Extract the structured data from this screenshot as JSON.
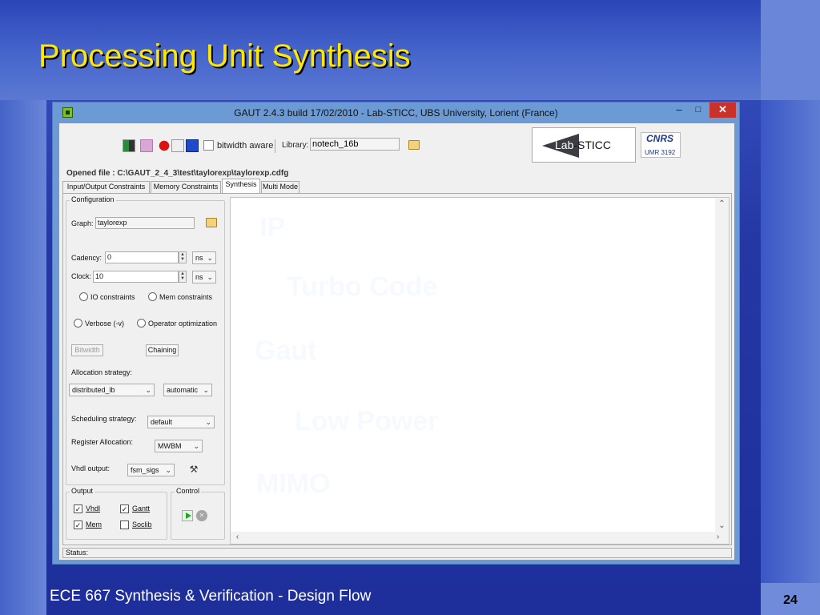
{
  "slide": {
    "title": "Processing Unit Synthesis",
    "footer": "ECE 667 Synthesis & Verification - Design Flow",
    "page_number": "24"
  },
  "window": {
    "title": "GAUT 2.4.3 build 17/02/2010 - Lab-STICC, UBS University, Lorient (France)",
    "minimize": "–",
    "maximize": "□",
    "close": "✕"
  },
  "toolbar": {
    "bitwidth_label": "bitwidth aware",
    "library_label": "Library:",
    "library_value": "notech_16b",
    "logo_lab": "Lab",
    "logo_sticc": "STICC",
    "logo_cnrs": "CNRS",
    "logo_umr": "UMR 3192"
  },
  "opened_file": "Opened file : C:\\GAUT_2_4_3\\test\\taylorexp\\taylorexp.cdfg",
  "tabs": [
    {
      "label": "Input/Output Constraints",
      "active": false
    },
    {
      "label": "Memory Constraints",
      "active": false
    },
    {
      "label": "Synthesis",
      "active": true
    },
    {
      "label": "Multi Mode",
      "active": false
    }
  ],
  "config": {
    "group_label": "Configuration",
    "graph_label": "Graph:",
    "graph_value": "taylorexp",
    "cadency_label": "Cadency:",
    "cadency_value": "0",
    "cadency_unit": "ns",
    "clock_label": "Clock:",
    "clock_value": "10",
    "clock_unit": "ns",
    "io_constraints": "IO constraints",
    "mem_constraints": "Mem constraints",
    "verbose": "Verbose (-v)",
    "operator_opt": "Operator optimization",
    "bitwidth_button": "Bitwidth",
    "chaining_button": "Chaining",
    "allocation_label": "Allocation strategy:",
    "allocation_value": "distributed_lb",
    "allocation_mode": "automatic",
    "scheduling_label": "Scheduling strategy:",
    "scheduling_value": "default",
    "register_label": "Register Allocation:",
    "register_value": "MWBM",
    "vhdl_label": "Vhdl output:",
    "vhdl_value": "fsm_sigs"
  },
  "output": {
    "group_label": "Output",
    "vhdl": "Vhdl",
    "gantt": "Gantt",
    "mem": "Mem",
    "soclib": "Soclib"
  },
  "control": {
    "group_label": "Control"
  },
  "watermarks": [
    "IP",
    "Turbo Code",
    "Gaut",
    "Low Power",
    "MIMO"
  ],
  "status": "Status:"
}
